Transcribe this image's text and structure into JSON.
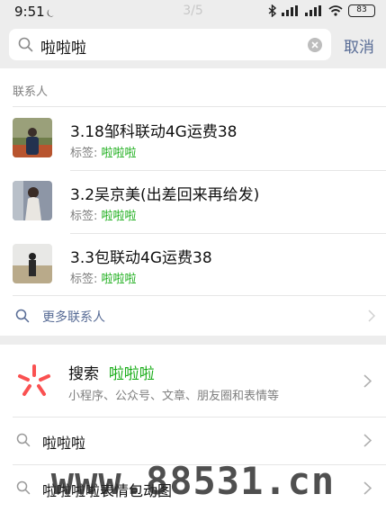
{
  "status_bar": {
    "time": "9:51",
    "page_indicator": "3/5",
    "battery": "83"
  },
  "search": {
    "query": "啦啦啦",
    "cancel_label": "取消"
  },
  "contacts_section": {
    "label": "联系人",
    "items": [
      {
        "name": "3.18邹科联动4G运费38",
        "tag_label": "标签: ",
        "tag_value": "啦啦啦"
      },
      {
        "name": "3.2吴京美(出差回来再给发)",
        "tag_label": "标签: ",
        "tag_value": "啦啦啦"
      },
      {
        "name": "3.3包联动4G运费38",
        "tag_label": "标签: ",
        "tag_value": "啦啦啦"
      }
    ],
    "more_label": "更多联系人"
  },
  "web_search": {
    "prefix": "搜索",
    "query": "啦啦啦",
    "subtitle": "小程序、公众号、文章、朋友圈和表情等"
  },
  "suggestions": [
    {
      "text": "啦啦啦"
    },
    {
      "text": "啦啦啦啦表情包动图"
    }
  ],
  "watermark": "www.88531.cn",
  "colors": {
    "accent_green": "#1aad19",
    "link_blue": "#576b95",
    "logo_red": "#fa5151"
  }
}
